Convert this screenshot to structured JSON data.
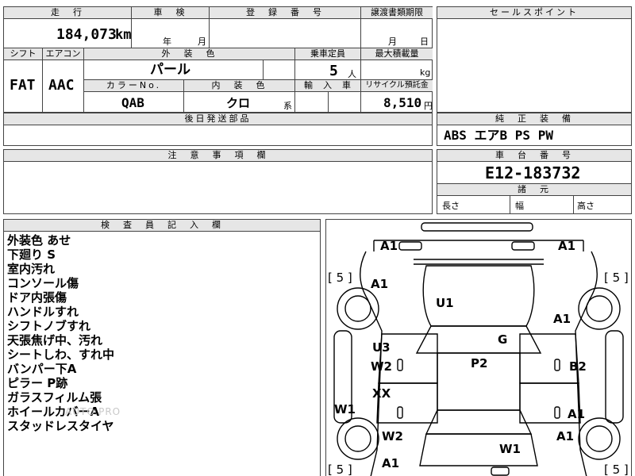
{
  "top_row": {
    "mileage_header": "走　行",
    "mileage_value": "184,073",
    "mileage_unit": "km",
    "inspection_header": "車　検",
    "year_label": "年",
    "month_label": "月",
    "reg_header": "登　録　番　号",
    "transfer_header": "譲渡書類期限",
    "transfer_month": "月",
    "transfer_day": "日",
    "sales_point_header": "セールスポイント"
  },
  "row2": {
    "shift_header": "シフト",
    "aircon_header": "エアコン",
    "exterior_header": "外　装　色",
    "capacity_header": "乗車定員",
    "maxload_header": "最大積載量",
    "shift_value": "FAT",
    "aircon_value": "AAC",
    "exterior_value": "パール",
    "capacity_value": "5",
    "capacity_unit": "人",
    "maxload_unit": "kg",
    "color_no_header": "カラーNo.",
    "interior_header": "内　装　色",
    "import_header": "輸　入　車",
    "recycle_header": "リサイクル預託金",
    "color_no_value": "QAB",
    "interior_value": "クロ",
    "interior_suffix": "系",
    "recycle_value": "8,510",
    "recycle_unit": "円"
  },
  "later_parts_header": "後日発送部品",
  "genuine_header": "純　正　装　備",
  "genuine_value": "ABS エアB PS PW",
  "caution_header": "注　意　事　項　欄",
  "chassis_header": "車　台　番　号",
  "chassis_value": "E12-183732",
  "dims_header": "諸　元",
  "dims": {
    "length": "長さ",
    "width": "幅",
    "height": "高さ"
  },
  "inspector_header": "検　査　員　記　入　欄",
  "inspector_notes": [
    "外装色 あせ",
    "下廻り S",
    "室内汚れ",
    "コンソール傷",
    "ドア内張傷",
    "ハンドルすれ",
    "シフトノブすれ",
    "天張焦げ中、汚れ",
    "シートしわ、すれ中",
    "バンパー下A",
    "ピラー P跡",
    "ガラスフィルム張",
    "ホイールカバーA",
    "スタッドレスタイヤ"
  ],
  "watermark": "AUTO.PRO",
  "diagram": {
    "tire_marks": [
      "[ 5 ]",
      "[ 5 ]",
      "[ 5 ]",
      "[ 5 ]"
    ],
    "damage_codes": {
      "front_left_corner": "A1",
      "front_right_corner": "A1",
      "left_fender": "A1",
      "hood": "U1",
      "right_fender": "A1",
      "windshield": "G",
      "left_front_door_upper": "U3",
      "left_front_door": "W2",
      "roof": "P2",
      "right_front_door": "B2",
      "left_rear_door": "XX",
      "left_rocker": "W1",
      "right_rear_door": "A1",
      "left_rear_fender": "W2",
      "trunk": "W1",
      "right_rear_fender": "A1",
      "rear_left_corner": "A1"
    }
  }
}
